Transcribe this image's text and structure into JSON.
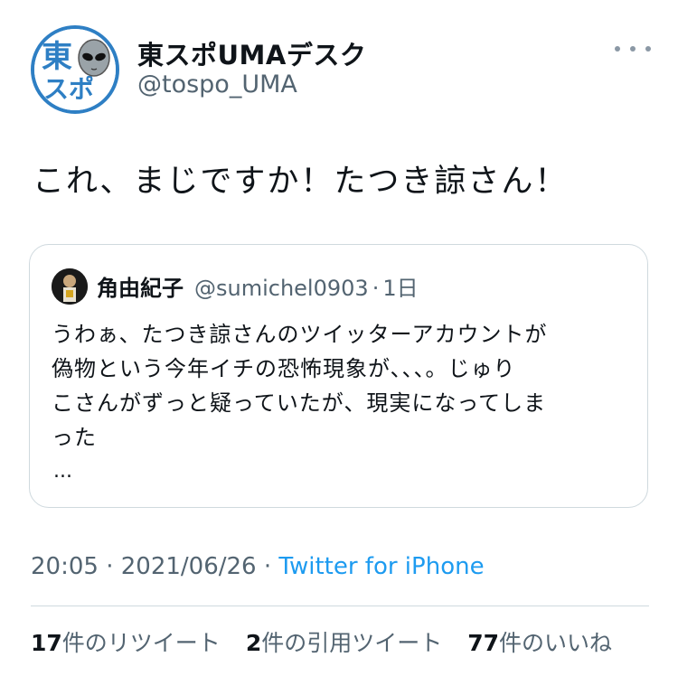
{
  "author": {
    "display_name": "東スポUMAデスク",
    "handle": "@tospo_UMA",
    "avatar_text_top": "東",
    "avatar_text_bottom": "スポ"
  },
  "tweet": {
    "text": "これ、まじですか！たつき諒さん！"
  },
  "quote": {
    "name": "角由紀子",
    "handle": "@sumichel0903",
    "dot": "·",
    "time": "1日",
    "lines": [
      "うわぁ、たつき諒さんのツイッターアカウントが",
      "偽物という今年イチの恐怖現象が、、、。じゅり",
      "こさんがずっと疑っていたが、現実になってしま",
      "った"
    ],
    "ellipsis": "..."
  },
  "meta": {
    "time": "20:05",
    "date": "2021/06/26",
    "sep": "·",
    "client": "Twitter for iPhone"
  },
  "stats": {
    "retweets_count": "17",
    "retweets_label": "件のリツイート",
    "quotes_count": "2",
    "quotes_label": "件の引用ツイート",
    "likes_count": "77",
    "likes_label": "件のいいね"
  },
  "colors": {
    "link": "#1d9bf0",
    "secondary_text": "#536471",
    "avatar_blue": "#2e7fc4"
  }
}
